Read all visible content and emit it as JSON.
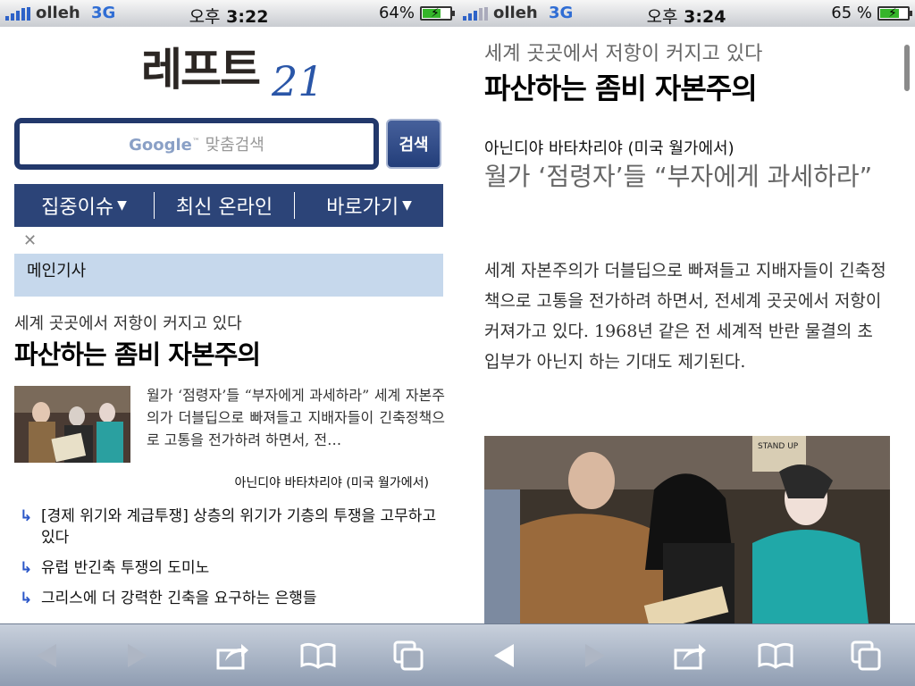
{
  "screens": [
    {
      "status": {
        "carrier": "olleh",
        "network": "3G",
        "ampm": "오후",
        "time": "3:22",
        "battery": "64%",
        "battery_level": 0.64
      },
      "logo": {
        "text": "레프트",
        "number": "21"
      },
      "search": {
        "placeholder_brand": "Google",
        "placeholder_tm": "™",
        "placeholder_text": "맞춤검색",
        "button": "검색"
      },
      "nav": [
        {
          "label": "집중이슈",
          "icon": "caret-down-icon"
        },
        {
          "label": "최신 온라인"
        },
        {
          "label": "바로가기",
          "icon": "caret-down-icon"
        }
      ],
      "close_icon": "close-icon",
      "section_title": "메인기사",
      "article": {
        "kicker": "세계 곳곳에서 저항이 커지고 있다",
        "headline": "파산하는 좀비 자본주의",
        "summary": "월가 ‘점령자’들 “부자에게 과세하라” 세계 자본주의가 더블딥으로 빠져들고 지배자들이 긴축정책으로 고통을 전가하려 하면서, 전…",
        "byline": "아닌디야 바타차리야 (미국 월가에서)"
      },
      "related": [
        "[경제 위기와 계급투쟁] 상층의 위기가 기층의 투쟁을 고무하고 있다",
        "유럽 반긴축 투쟁의 도미노",
        "그리스에 더 강력한 긴축을 요구하는 은행들"
      ],
      "related_icon": "↳"
    },
    {
      "status": {
        "carrier": "olleh",
        "network": "3G",
        "ampm": "오후",
        "time": "3:24",
        "battery": "65 %",
        "battery_level": 0.65
      },
      "article": {
        "kicker": "세계 곳곳에서 저항이 커지고 있다",
        "headline": "파산하는 좀비 자본주의",
        "byline": "아닌디야 바타차리야 (미국 월가에서)",
        "subheadline": "월가 ‘점령자’들 “부자에게 과세하라”",
        "body": "세계 자본주의가 더블딥으로 빠져들고 지배자들이 긴축정책으로 고통을 전가하려 하면서, 전세계 곳곳에서 저항이 커져가고 있다. 1968년 같은 전 세계적 반란 물결의 초입부가 아닌지 하는 기대도 제기된다."
      },
      "photo_sign_text": "STAND UP"
    }
  ],
  "toolbar": {
    "icons": [
      "back-arrow-icon",
      "forward-arrow-icon",
      "share-icon",
      "bookmarks-icon",
      "pages-icon"
    ]
  },
  "colors": {
    "nav_bg": "#2c4478",
    "section_bg": "#c6d8ec",
    "toolbar": "#9aa6b8",
    "link_arrow": "#2a56c8"
  }
}
